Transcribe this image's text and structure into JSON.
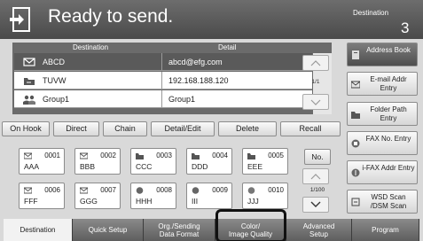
{
  "header": {
    "title": "Ready to send.",
    "destination_label": "Destination",
    "destination_count": "3"
  },
  "table": {
    "col_destination": "Destination",
    "col_detail": "Detail",
    "rows": [
      {
        "name": "ABCD",
        "detail": "abcd@efg.com",
        "icon": "email-icon"
      },
      {
        "name": "TUVW",
        "detail": "192.168.188.120",
        "icon": "folder-icon"
      },
      {
        "name": "Group1",
        "detail": "Group1",
        "icon": "group-icon"
      }
    ],
    "page": "1/1"
  },
  "actions": {
    "on_hook": "On Hook",
    "direct": "Direct",
    "chain": "Chain",
    "detail_edit": "Detail/Edit",
    "delete": "Delete",
    "recall": "Recall"
  },
  "side_buttons": {
    "address_book": "Address Book",
    "email_entry": "E-mail Addr Entry",
    "folder_entry": "Folder Path Entry",
    "fax_entry": "FAX No. Entry",
    "ifax_entry": "i-FAX Addr Entry",
    "wsd_scan": "WSD Scan /DSM Scan"
  },
  "one_touch": {
    "keys": [
      {
        "num": "0001",
        "name": "AAA"
      },
      {
        "num": "0002",
        "name": "BBB"
      },
      {
        "num": "0003",
        "name": "CCC"
      },
      {
        "num": "0004",
        "name": "DDD"
      },
      {
        "num": "0005",
        "name": "EEE"
      },
      {
        "num": "0006",
        "name": "FFF"
      },
      {
        "num": "0007",
        "name": "GGG"
      },
      {
        "num": "0008",
        "name": "HHH"
      },
      {
        "num": "0009",
        "name": "III"
      },
      {
        "num": "0010",
        "name": "JJJ"
      }
    ],
    "no_label": "No.",
    "page": "1/100"
  },
  "tabs": {
    "destination": "Destination",
    "quick_setup": "Quick Setup",
    "org_line1": "Org./Sending",
    "org_line2": "Data Format",
    "color_line1": "Color/",
    "color_line2": "Image Quality",
    "advanced_line1": "Advanced",
    "advanced_line2": "Setup",
    "program": "Program"
  }
}
